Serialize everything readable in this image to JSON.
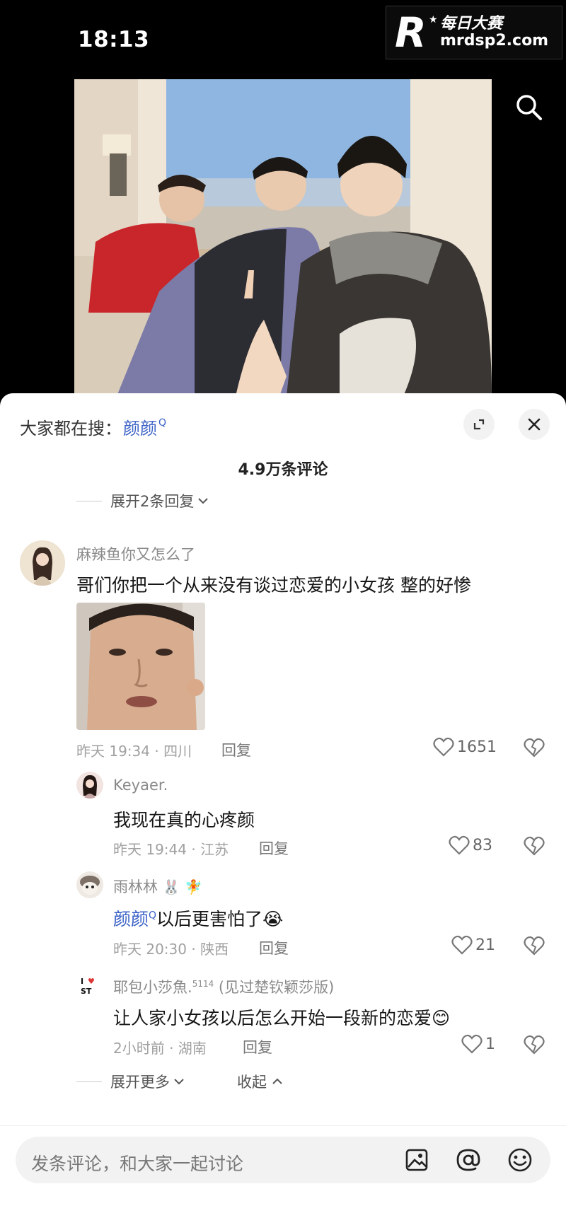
{
  "status": {
    "time": "18:13"
  },
  "watermark": {
    "title": "每日大赛",
    "url": "mrdsp2.com"
  },
  "search_bar": {
    "prefix": "大家都在搜：",
    "term": "颜颜",
    "q": "Q"
  },
  "comments_header": {
    "count": "4.9万条评论"
  },
  "prev_expand": "展开2条回复",
  "comments": [
    {
      "username": "麻辣鱼你又怎么了",
      "text": "哥们你把一个从来没有谈过恋爱的小女孩 整的好惨",
      "meta": "昨天 19:34 · 四川",
      "reply": "回复",
      "likes": "1651",
      "replies": [
        {
          "username": "Keyaer.",
          "text": "我现在真的心疼颜",
          "meta": "昨天 19:44 · 江苏",
          "reply": "回复",
          "likes": "83"
        },
        {
          "username": "雨林林",
          "mention": "颜颜",
          "mention_q": "Q",
          "text": "以后更害怕了",
          "emoji": "😭",
          "meta": "昨天 20:30 · 陕西",
          "reply": "回复",
          "likes": "21"
        },
        {
          "username": "耶包小莎魚.",
          "username_sup": "5114",
          "username_extra": "(见过楚钦颖莎版)",
          "text": "让人家小女孩以后怎么开始一段新的恋爱",
          "emoji": "😊",
          "meta": "2小时前 · 湖南",
          "reply": "回复",
          "likes": "1"
        }
      ]
    }
  ],
  "more": {
    "expand": "展开更多",
    "collapse": "收起"
  },
  "input": {
    "placeholder": "发条评论，和大家一起讨论"
  }
}
